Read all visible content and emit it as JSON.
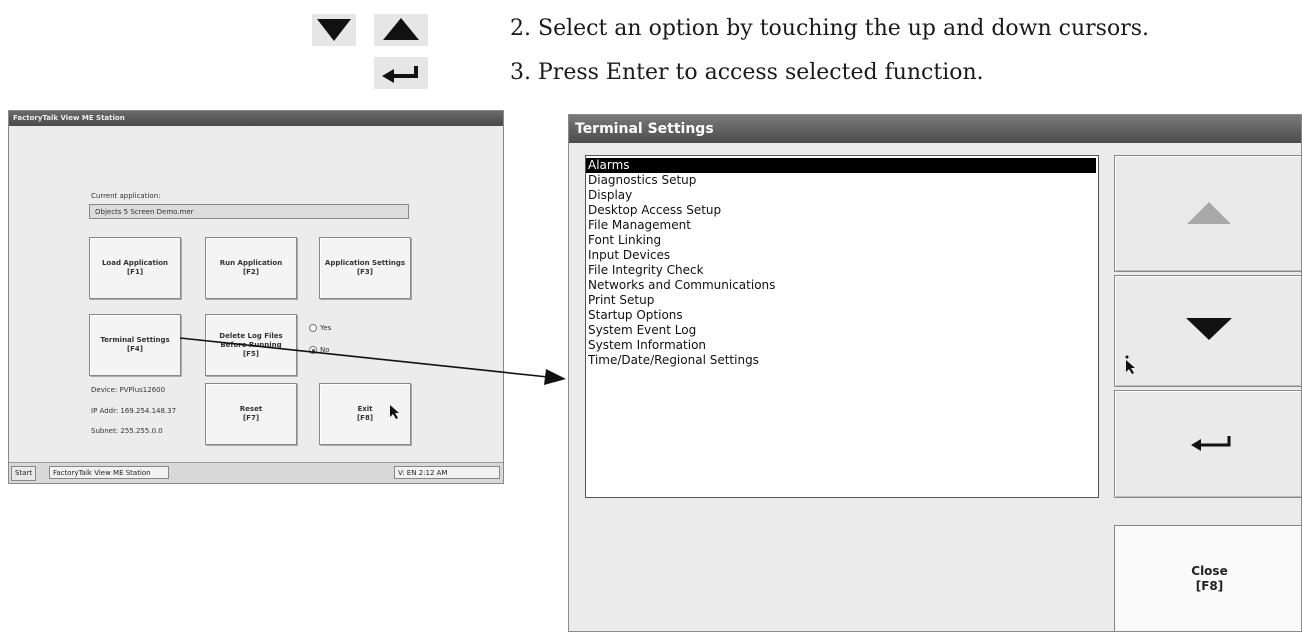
{
  "instructions": {
    "step2": {
      "number": "2.",
      "text": "Select an option by touching the up and down cursors."
    },
    "step3": {
      "number": "3.",
      "text": "Press Enter to access selected function."
    },
    "icons": [
      "down-arrow-icon",
      "up-arrow-icon",
      "enter-icon"
    ]
  },
  "screenshot": {
    "title": "FactoryTalk View ME Station",
    "current_application_label": "Current application:",
    "current_application_value": "Objects 5 Screen Demo.mer",
    "buttons": {
      "load": "Load Application\n[F1]",
      "run": "Run Application\n[F2]",
      "app_settings": "Application Settings\n[F3]",
      "terminal_settings": "Terminal Settings\n[F4]",
      "delete_logs": "Delete Log Files\nBefore Running\n[F5]",
      "reset": "Reset\n[F7]",
      "exit": "Exit\n[F8]"
    },
    "radio_yes": "Yes",
    "radio_no": "No",
    "device": "Device: PVPlus12600",
    "ip_addr": "IP Addr: 169.254.148.37",
    "subnet": "Subnet: 255.255.0.0",
    "taskbar": {
      "start": "Start",
      "app": "FactoryTalk View ME Station",
      "tray": "V: EN 2:12 AM"
    }
  },
  "dialog": {
    "title": "Terminal Settings",
    "items": [
      "Alarms",
      "Diagnostics Setup",
      "Display",
      "Desktop Access Setup",
      "File Management",
      "Font Linking",
      "Input Devices",
      "File Integrity Check",
      "Networks and Communications",
      "Print Setup",
      "Startup Options",
      "System Event Log",
      "System Information",
      "Time/Date/Regional Settings"
    ],
    "selected_index": 0,
    "close_button": "Close\n[F8]"
  }
}
